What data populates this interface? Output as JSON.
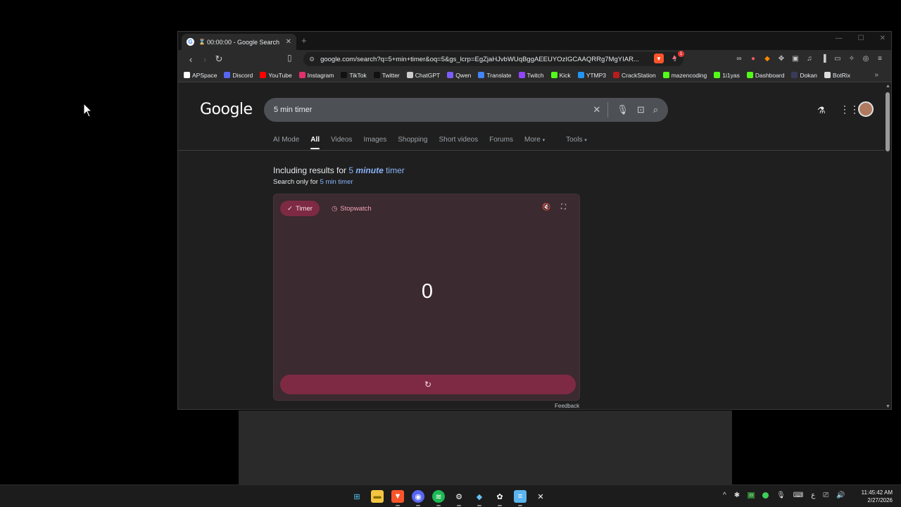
{
  "window": {
    "tab_title": "00:00:00 - Google Search",
    "tab_hourglass": "⌛",
    "new_tab_symbol": "+",
    "url": "google.com/search?q=5+min+timer&oq=5&gs_lcrp=EgZjaHJvbWUqBggAEEUYOzIGCAAQRRg7MgYIAR...",
    "rewards_badge": "1"
  },
  "bookmarks": [
    {
      "label": "APSpace",
      "color": "#ffffff"
    },
    {
      "label": "Discord",
      "color": "#5865f2"
    },
    {
      "label": "YouTube",
      "color": "#ff0000"
    },
    {
      "label": "Instagram",
      "color": "#e1306c"
    },
    {
      "label": "TikTok",
      "color": "#111111"
    },
    {
      "label": "Twitter",
      "color": "#111111"
    },
    {
      "label": "ChatGPT",
      "color": "#cccccc"
    },
    {
      "label": "Qwen",
      "color": "#7c5cff"
    },
    {
      "label": "Translate",
      "color": "#4285f4"
    },
    {
      "label": "Twitch",
      "color": "#9146ff"
    },
    {
      "label": "Kick",
      "color": "#53fc18"
    },
    {
      "label": "YTMP3",
      "color": "#2196f3"
    },
    {
      "label": "CrackStation",
      "color": "#b71c1c"
    },
    {
      "label": "mazencoding",
      "color": "#53fc18"
    },
    {
      "label": "1i1yas",
      "color": "#53fc18"
    },
    {
      "label": "Dashboard",
      "color": "#53fc18"
    },
    {
      "label": "Dokan",
      "color": "#3a3a5a"
    },
    {
      "label": "BotRix",
      "color": "#dddddd"
    }
  ],
  "google": {
    "logo": "Google",
    "query": "5 min timer",
    "tabs": [
      "AI Mode",
      "All",
      "Videos",
      "Images",
      "Shopping",
      "Short videos",
      "Forums",
      "More",
      "Tools"
    ],
    "including_prefix": "Including results for ",
    "including_num": "5 ",
    "including_em": "minute",
    "including_rest": " timer",
    "search_only_prefix": "Search only for ",
    "search_only_link": "5 min timer"
  },
  "timer": {
    "timer_tab": "Timer",
    "stopwatch_tab": "Stopwatch",
    "value": "0",
    "feedback": "Feedback"
  },
  "clock": {
    "time": "11:45:42 AM",
    "date": "2/27/2026"
  },
  "colors": {
    "accent": "#7e2a44",
    "card_bg": "#3b2a2f",
    "link": "#8ab4f8"
  }
}
